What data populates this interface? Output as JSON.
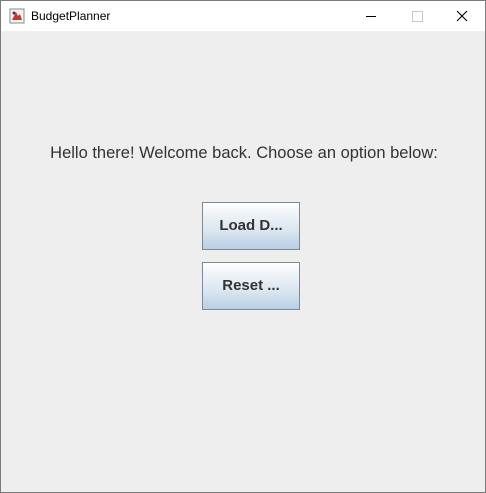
{
  "window": {
    "title": "BudgetPlanner",
    "controls": {
      "minimize": "minimize-icon",
      "maximize": "maximize-icon",
      "close": "close-icon"
    }
  },
  "main": {
    "welcome_text": "Hello there! Welcome back. Choose an option below:",
    "buttons": {
      "load_label": "Load D...",
      "reset_label": "Reset ..."
    }
  },
  "colors": {
    "background": "#eeeeee",
    "button_border": "#7a8a99",
    "button_gradient_top": "#ffffff",
    "button_gradient_bottom": "#b8cfe5"
  }
}
